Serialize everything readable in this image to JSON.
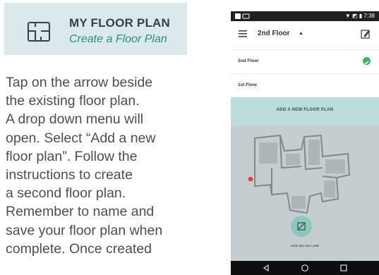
{
  "plan_card": {
    "title": "MY FLOOR PLAN",
    "subtitle": "Create a Floor Plan",
    "icon": "floor-plan-icon"
  },
  "instructions": "Tap on the arrow beside\nthe existing floor plan.\nA drop down menu will\nopen. Select “Add a new\nfloor plan”. Follow the\ninstructions to create\na second floor plan.\nRemember to name and\nsave your floor plan when\ncomplete. Once created",
  "phone": {
    "status": {
      "time": "7:38"
    },
    "appbar": {
      "floor_title": "2nd Floor",
      "caret": "▲"
    },
    "floors": [
      {
        "label": "2nd Floor",
        "selected": true
      },
      {
        "label": "1st Floor",
        "selected": false
      }
    ],
    "add_plan_label": "ADD A NEW FLOOR PLAN",
    "nogo_label": "ADD NO-GO LINE",
    "colors": {
      "accent": "#bcdcd9",
      "check": "#3bb371",
      "nogo": "#8fc7bf"
    }
  }
}
